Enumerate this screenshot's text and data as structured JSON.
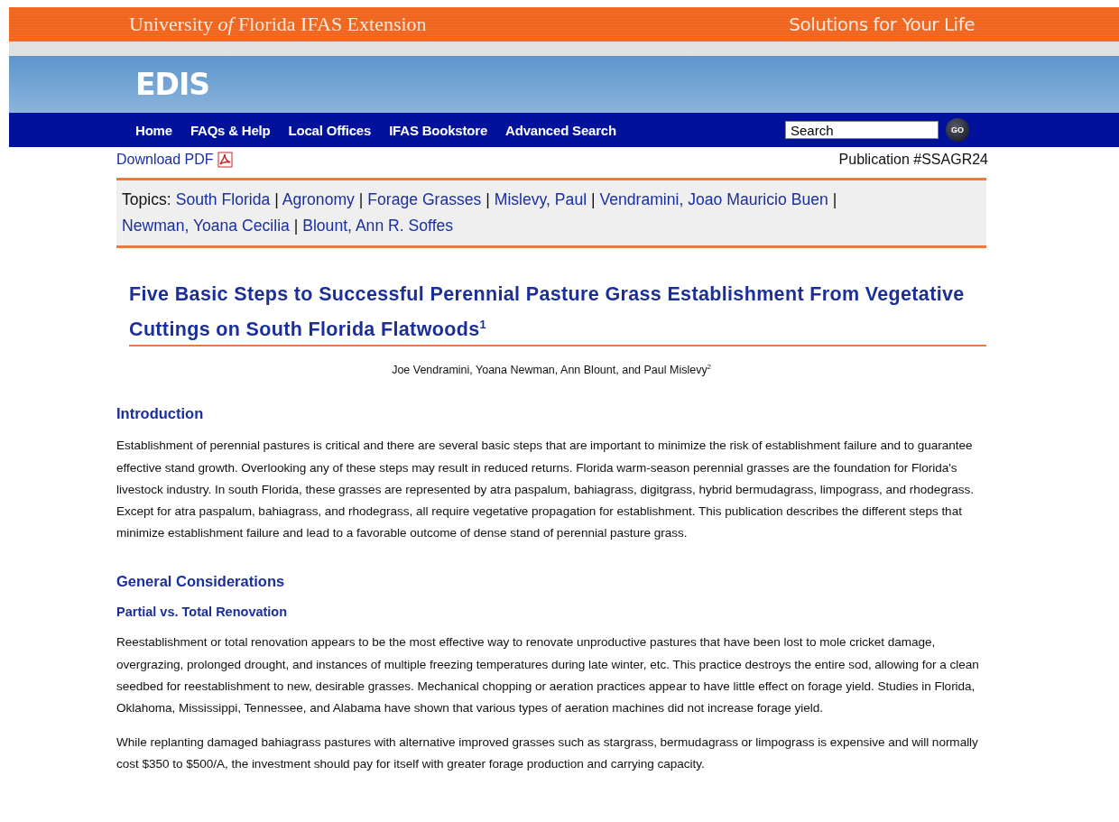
{
  "banner": {
    "title": "University *of* Florida  IFAS Extension",
    "tagline": "Solutions for Your Life"
  },
  "site": {
    "name": "EDIS"
  },
  "nav": {
    "items": [
      "Home",
      "FAQs & Help",
      "Local Offices",
      "IFAS Bookstore",
      "Advanced Search"
    ],
    "search": {
      "value": "Search",
      "button": "GO"
    }
  },
  "toolbar": {
    "download": "Download PDF",
    "publication": "Publication #SSAGR24"
  },
  "topics": {
    "label": "Topics:",
    "separator": "|",
    "links": [
      "South Florida",
      "Agronomy",
      "Forage Grasses",
      "Mislevy, Paul",
      "Vendramini, Joao Mauricio Buen",
      "Newman, Yoana Cecilia",
      "Blount, Ann R. Soffes"
    ]
  },
  "article": {
    "title": "Five Basic Steps to Successful Perennial Pasture Grass Establishment From Vegetative Cuttings on South Florida Flatwoods$^{1}$",
    "authors": "Joe Vendramini, Yoana Newman, Ann Blount, and Paul Mislevy$^{2}$",
    "sections": [
      {
        "kind": "heading",
        "text": "Introduction"
      },
      {
        "kind": "paragraph",
        "text": "Establishment of perennial pastures is critical and there are several basic steps that are important to minimize the risk of establishment failure and to guarantee effective stand growth. Overlooking any of these steps may result in reduced returns. Florida warm-season perennial grasses are the foundation for Florida's livestock industry. In south Florida, these grasses are represented by atra paspalum, bahiagrass, digitgrass, hybrid bermudagrass, limpograss, and rhodegrass. Except for atra paspalum, bahiagrass, and rhodegrass, all require vegetative propagation for establishment. This publication describes the different steps that minimize establishment failure and lead to a favorable outcome of dense stand of perennial pasture grass."
      },
      {
        "kind": "heading",
        "text": "General Considerations"
      },
      {
        "kind": "subheading",
        "text": "Partial vs. Total Renovation"
      },
      {
        "kind": "paragraph",
        "text": "Reestablishment or total renovation appears to be the most effective way to renovate unproductive pastures that have been lost to mole cricket damage, overgrazing, prolonged drought, and instances of multiple freezing temperatures during late winter, etc. This practice destroys the entire sod, allowing for a clean seedbed for reestablishment to new, desirable grasses. Mechanical chopping or aeration practices appear to have little effect on forage yield. Studies in Florida, Oklahoma, Mississippi, Tennessee, and Alabama have shown that various types of aeration machines did not increase forage yield."
      },
      {
        "kind": "paragraph",
        "text": "While replanting damaged bahiagrass pastures with alternative improved grasses such as stargrass, bermudagrass or limpograss is expensive and will normally cost $350 to $500/A, the investment should pay for itself with greater forage production and carrying capacity."
      }
    ]
  }
}
